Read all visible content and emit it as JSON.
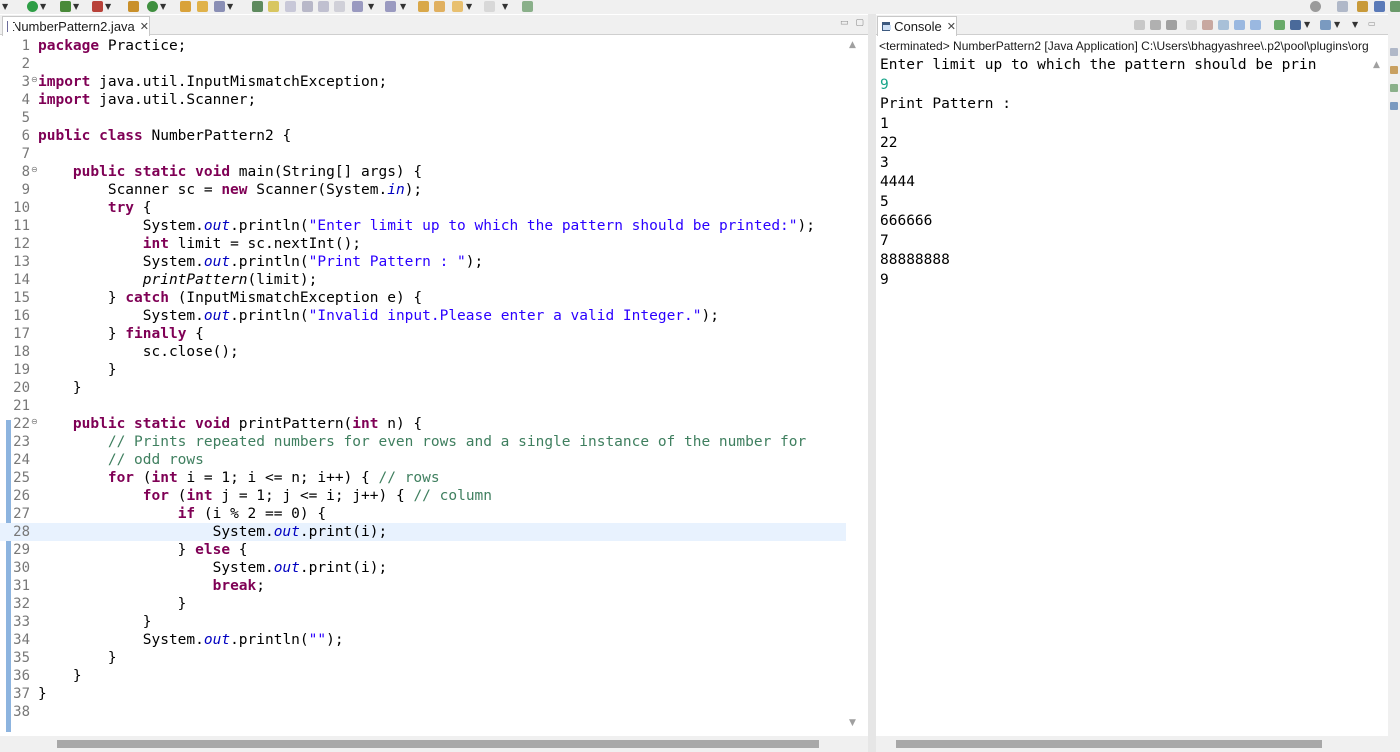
{
  "editor": {
    "tab_title": "NumberPattern2.java",
    "tab_close": "✕",
    "lines": [
      {
        "n": "1",
        "fold": "",
        "html": "<span class=\"kw\">package</span> Practice;"
      },
      {
        "n": "2",
        "fold": "",
        "html": ""
      },
      {
        "n": "3",
        "fold": "⊖",
        "html": "<span class=\"kw\">import</span> java.util.InputMismatchException;"
      },
      {
        "n": "4",
        "fold": "",
        "html": "<span class=\"kw\">import</span> java.util.Scanner;"
      },
      {
        "n": "5",
        "fold": "",
        "html": ""
      },
      {
        "n": "6",
        "fold": "",
        "html": "<span class=\"kw\">public class</span> NumberPattern2 {"
      },
      {
        "n": "7",
        "fold": "",
        "html": ""
      },
      {
        "n": "8",
        "fold": "⊖",
        "html": "    <span class=\"kw\">public static void</span> main(String[] args) {"
      },
      {
        "n": "9",
        "fold": "",
        "html": "        Scanner sc = <span class=\"kw\">new</span> Scanner(System.<span class=\"fld\">in</span>);"
      },
      {
        "n": "10",
        "fold": "",
        "html": "        <span class=\"kw\">try</span> {"
      },
      {
        "n": "11",
        "fold": "",
        "html": "            System.<span class=\"fld\">out</span>.println(<span class=\"str\">\"Enter limit up to which the pattern should be printed:\"</span>);"
      },
      {
        "n": "12",
        "fold": "",
        "html": "            <span class=\"kw\">int</span> limit = sc.nextInt();"
      },
      {
        "n": "13",
        "fold": "",
        "html": "            System.<span class=\"fld\">out</span>.println(<span class=\"str\">\"Print Pattern : \"</span>);"
      },
      {
        "n": "14",
        "fold": "",
        "html": "            <span class=\"sm\">printPattern</span>(limit);"
      },
      {
        "n": "15",
        "fold": "",
        "html": "        } <span class=\"kw\">catch</span> (InputMismatchException e) {"
      },
      {
        "n": "16",
        "fold": "",
        "html": "            System.<span class=\"fld\">out</span>.println(<span class=\"str\">\"Invalid input.Please enter a valid Integer.\"</span>);"
      },
      {
        "n": "17",
        "fold": "",
        "html": "        } <span class=\"kw\">finally</span> {"
      },
      {
        "n": "18",
        "fold": "",
        "html": "            sc.close();"
      },
      {
        "n": "19",
        "fold": "",
        "html": "        }"
      },
      {
        "n": "20",
        "fold": "",
        "html": "    }"
      },
      {
        "n": "21",
        "fold": "",
        "html": ""
      },
      {
        "n": "22",
        "fold": "⊖",
        "html": "    <span class=\"kw\">public static void</span> printPattern(<span class=\"kw\">int</span> n) {"
      },
      {
        "n": "23",
        "fold": "",
        "html": "        <span class=\"com\">// Prints repeated numbers for even rows and a single instance of the number for</span>"
      },
      {
        "n": "24",
        "fold": "",
        "html": "        <span class=\"com\">// odd rows</span>"
      },
      {
        "n": "25",
        "fold": "",
        "html": "        <span class=\"kw\">for</span> (<span class=\"kw\">int</span> i = 1; i &lt;= n; i++) { <span class=\"com\">// rows</span>"
      },
      {
        "n": "26",
        "fold": "",
        "html": "            <span class=\"kw\">for</span> (<span class=\"kw\">int</span> j = 1; j &lt;= i; j++) { <span class=\"com\">// column</span>"
      },
      {
        "n": "27",
        "fold": "",
        "html": "                <span class=\"kw\">if</span> (i % 2 == 0) {"
      },
      {
        "n": "28",
        "fold": "",
        "html": "                    System.<span class=\"fld\">out</span>.print(i);"
      },
      {
        "n": "29",
        "fold": "",
        "html": "                } <span class=\"kw\">else</span> {"
      },
      {
        "n": "30",
        "fold": "",
        "html": "                    System.<span class=\"fld\">out</span>.print(i);"
      },
      {
        "n": "31",
        "fold": "",
        "html": "                    <span class=\"kw\">break</span>;"
      },
      {
        "n": "32",
        "fold": "",
        "html": "                }"
      },
      {
        "n": "33",
        "fold": "",
        "html": "            }"
      },
      {
        "n": "34",
        "fold": "",
        "html": "            System.<span class=\"fld\">out</span>.println(<span class=\"str\">\"\"</span>);"
      },
      {
        "n": "35",
        "fold": "",
        "html": "        }"
      },
      {
        "n": "36",
        "fold": "",
        "html": "    }"
      },
      {
        "n": "37",
        "fold": "",
        "html": "}"
      },
      {
        "n": "38",
        "fold": "",
        "html": ""
      }
    ],
    "current_line": "28"
  },
  "console": {
    "tab_title": "Console",
    "tab_close": "✕",
    "status": "<terminated> NumberPattern2 [Java Application] C:\\Users\\bhagyashree\\.p2\\pool\\plugins\\org",
    "output": [
      {
        "text": "Enter limit up to which the pattern should be prin",
        "input": false
      },
      {
        "text": "9",
        "input": true
      },
      {
        "text": "Print Pattern :",
        "input": false
      },
      {
        "text": "1",
        "input": false
      },
      {
        "text": "22",
        "input": false
      },
      {
        "text": "3",
        "input": false
      },
      {
        "text": "4444",
        "input": false
      },
      {
        "text": "5",
        "input": false
      },
      {
        "text": "666666",
        "input": false
      },
      {
        "text": "7",
        "input": false
      },
      {
        "text": "88888888",
        "input": false
      },
      {
        "text": "9",
        "input": false
      }
    ]
  },
  "icons": {
    "run": "run-icon",
    "debug": "debug-icon",
    "terminate": "terminate-icon",
    "remove_launch": "remove-launch-icon",
    "clear_console": "clear-console-icon",
    "scroll_lock": "scroll-lock-icon",
    "pin_console": "pin-console-icon",
    "search": "search-icon"
  },
  "colors": {
    "keyword": "#7f0055",
    "string": "#2a00ff",
    "comment": "#3f7f5f",
    "field": "#0000c0",
    "console_input": "#17a589",
    "current_line": "#e8f2fe"
  }
}
